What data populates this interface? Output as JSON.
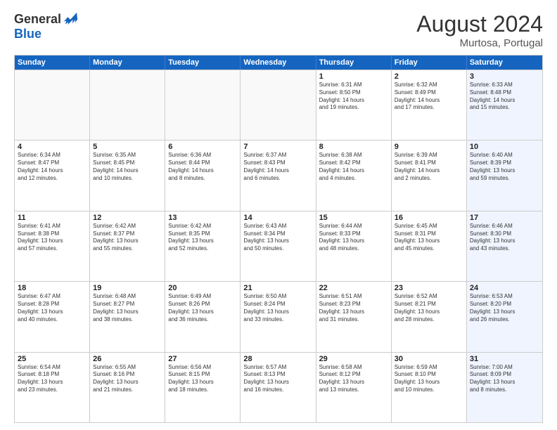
{
  "logo": {
    "general": "General",
    "blue": "Blue"
  },
  "header": {
    "month_year": "August 2024",
    "location": "Murtosa, Portugal"
  },
  "weekdays": [
    "Sunday",
    "Monday",
    "Tuesday",
    "Wednesday",
    "Thursday",
    "Friday",
    "Saturday"
  ],
  "rows": [
    [
      {
        "day": "",
        "info": ""
      },
      {
        "day": "",
        "info": ""
      },
      {
        "day": "",
        "info": ""
      },
      {
        "day": "",
        "info": ""
      },
      {
        "day": "1",
        "info": "Sunrise: 6:31 AM\nSunset: 8:50 PM\nDaylight: 14 hours\nand 19 minutes."
      },
      {
        "day": "2",
        "info": "Sunrise: 6:32 AM\nSunset: 8:49 PM\nDaylight: 14 hours\nand 17 minutes."
      },
      {
        "day": "3",
        "info": "Sunrise: 6:33 AM\nSunset: 8:48 PM\nDaylight: 14 hours\nand 15 minutes."
      }
    ],
    [
      {
        "day": "4",
        "info": "Sunrise: 6:34 AM\nSunset: 8:47 PM\nDaylight: 14 hours\nand 12 minutes."
      },
      {
        "day": "5",
        "info": "Sunrise: 6:35 AM\nSunset: 8:45 PM\nDaylight: 14 hours\nand 10 minutes."
      },
      {
        "day": "6",
        "info": "Sunrise: 6:36 AM\nSunset: 8:44 PM\nDaylight: 14 hours\nand 8 minutes."
      },
      {
        "day": "7",
        "info": "Sunrise: 6:37 AM\nSunset: 8:43 PM\nDaylight: 14 hours\nand 6 minutes."
      },
      {
        "day": "8",
        "info": "Sunrise: 6:38 AM\nSunset: 8:42 PM\nDaylight: 14 hours\nand 4 minutes."
      },
      {
        "day": "9",
        "info": "Sunrise: 6:39 AM\nSunset: 8:41 PM\nDaylight: 14 hours\nand 2 minutes."
      },
      {
        "day": "10",
        "info": "Sunrise: 6:40 AM\nSunset: 8:39 PM\nDaylight: 13 hours\nand 59 minutes."
      }
    ],
    [
      {
        "day": "11",
        "info": "Sunrise: 6:41 AM\nSunset: 8:38 PM\nDaylight: 13 hours\nand 57 minutes."
      },
      {
        "day": "12",
        "info": "Sunrise: 6:42 AM\nSunset: 8:37 PM\nDaylight: 13 hours\nand 55 minutes."
      },
      {
        "day": "13",
        "info": "Sunrise: 6:42 AM\nSunset: 8:35 PM\nDaylight: 13 hours\nand 52 minutes."
      },
      {
        "day": "14",
        "info": "Sunrise: 6:43 AM\nSunset: 8:34 PM\nDaylight: 13 hours\nand 50 minutes."
      },
      {
        "day": "15",
        "info": "Sunrise: 6:44 AM\nSunset: 8:33 PM\nDaylight: 13 hours\nand 48 minutes."
      },
      {
        "day": "16",
        "info": "Sunrise: 6:45 AM\nSunset: 8:31 PM\nDaylight: 13 hours\nand 45 minutes."
      },
      {
        "day": "17",
        "info": "Sunrise: 6:46 AM\nSunset: 8:30 PM\nDaylight: 13 hours\nand 43 minutes."
      }
    ],
    [
      {
        "day": "18",
        "info": "Sunrise: 6:47 AM\nSunset: 8:28 PM\nDaylight: 13 hours\nand 40 minutes."
      },
      {
        "day": "19",
        "info": "Sunrise: 6:48 AM\nSunset: 8:27 PM\nDaylight: 13 hours\nand 38 minutes."
      },
      {
        "day": "20",
        "info": "Sunrise: 6:49 AM\nSunset: 8:26 PM\nDaylight: 13 hours\nand 36 minutes."
      },
      {
        "day": "21",
        "info": "Sunrise: 6:50 AM\nSunset: 8:24 PM\nDaylight: 13 hours\nand 33 minutes."
      },
      {
        "day": "22",
        "info": "Sunrise: 6:51 AM\nSunset: 8:23 PM\nDaylight: 13 hours\nand 31 minutes."
      },
      {
        "day": "23",
        "info": "Sunrise: 6:52 AM\nSunset: 8:21 PM\nDaylight: 13 hours\nand 28 minutes."
      },
      {
        "day": "24",
        "info": "Sunrise: 6:53 AM\nSunset: 8:20 PM\nDaylight: 13 hours\nand 26 minutes."
      }
    ],
    [
      {
        "day": "25",
        "info": "Sunrise: 6:54 AM\nSunset: 8:18 PM\nDaylight: 13 hours\nand 23 minutes."
      },
      {
        "day": "26",
        "info": "Sunrise: 6:55 AM\nSunset: 8:16 PM\nDaylight: 13 hours\nand 21 minutes."
      },
      {
        "day": "27",
        "info": "Sunrise: 6:56 AM\nSunset: 8:15 PM\nDaylight: 13 hours\nand 18 minutes."
      },
      {
        "day": "28",
        "info": "Sunrise: 6:57 AM\nSunset: 8:13 PM\nDaylight: 13 hours\nand 16 minutes."
      },
      {
        "day": "29",
        "info": "Sunrise: 6:58 AM\nSunset: 8:12 PM\nDaylight: 13 hours\nand 13 minutes."
      },
      {
        "day": "30",
        "info": "Sunrise: 6:59 AM\nSunset: 8:10 PM\nDaylight: 13 hours\nand 10 minutes."
      },
      {
        "day": "31",
        "info": "Sunrise: 7:00 AM\nSunset: 8:09 PM\nDaylight: 13 hours\nand 8 minutes."
      }
    ]
  ]
}
